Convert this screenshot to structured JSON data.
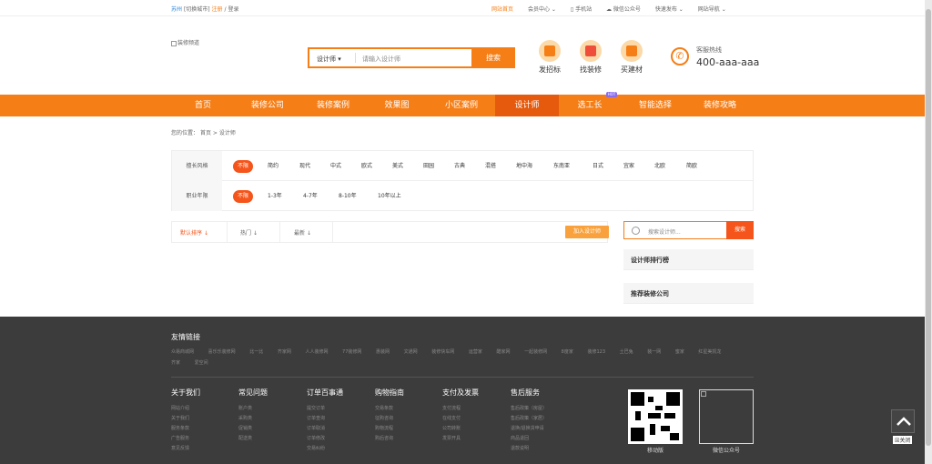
{
  "topbar": {
    "city": "苏州",
    "switch_city": "[切换城市]",
    "register": "注册",
    "slash": "/",
    "login": "登录",
    "site_home": "网站首页",
    "member_center": "会员中心",
    "mobile": "手机站",
    "wechat": "微信公众号",
    "quick_publish": "快速发布",
    "site_nav": "网站导航"
  },
  "header": {
    "logo_alt": "装修频道",
    "search_select": "设计师",
    "search_placeholder": "请输入设计师",
    "search_button": "搜索",
    "quick_links": [
      "发招标",
      "找装修",
      "买建材"
    ],
    "hotline_label": "客服热线",
    "hotline_number": "400-aaa-aaa"
  },
  "nav": {
    "items": [
      "首页",
      "装修公司",
      "装修案例",
      "效果图",
      "小区案例",
      "设计师",
      "选工长",
      "智能选择",
      "装修攻略"
    ],
    "active": "设计师",
    "hot_badge": "HOT"
  },
  "breadcrumb": {
    "prefix": "您的位置：",
    "home": "首页",
    "sep": ">",
    "current": "设计师"
  },
  "filters": {
    "style_label": "擅长风格",
    "styles": [
      "不限",
      "简约",
      "现代",
      "中式",
      "欧式",
      "美式",
      "田园",
      "古典",
      "混搭",
      "地中海",
      "东南亚",
      "日式",
      "宜家",
      "北欧",
      "简欧"
    ],
    "years_label": "职业年限",
    "years": [
      "不限",
      "1-3年",
      "4-7年",
      "8-10年",
      "10年以上"
    ]
  },
  "sort": {
    "default": "默认排序",
    "hot": "热门",
    "new": "最新",
    "arrow": "↓",
    "join_button": "加入设计师"
  },
  "sidebar": {
    "search_placeholder": "搜索设计师...",
    "search_button": "搜索",
    "rank_title": "设计师排行榜",
    "recommend_title": "推荐装修公司"
  },
  "footer": {
    "friend_links_title": "友情链接",
    "friend_links": [
      "众易商城网",
      "喜乐乐装修网",
      "比一比",
      "齐家网",
      "人人装修网",
      "77装修网",
      "惠装网",
      "文通网",
      "装修快车网",
      "运营家",
      "酷家网",
      "一起装修网",
      "8度家",
      "装修123",
      "土巴兔",
      "装一网",
      "蜜家",
      "红星美凯龙",
      "齐家",
      "爱空间"
    ],
    "columns": [
      {
        "title": "关于我们",
        "links": [
          "网站介绍",
          "关于我们",
          "服务条款",
          "广告服务",
          "意见反馈"
        ]
      },
      {
        "title": "常见问题",
        "links": [
          "账户类",
          "采购类",
          "促销类",
          "配送类"
        ]
      },
      {
        "title": "订单百事通",
        "links": [
          "提交订单",
          "订单查询",
          "订单取消",
          "订单修改",
          "交易纠纷"
        ]
      },
      {
        "title": "购物指南",
        "links": [
          "交易条款",
          "征购咨询",
          "购物流程",
          "购后咨询"
        ]
      },
      {
        "title": "支付及发票",
        "links": [
          "支付流程",
          "在线支付",
          "公司转账",
          "发票开具"
        ]
      },
      {
        "title": "售后服务",
        "links": [
          "售后政策（房屋）",
          "售后政策（家居）",
          "退换/退换货申请",
          "商品退回",
          "退款说明"
        ]
      }
    ],
    "qr_mobile_label": "移动版",
    "qr_wechat_label": "微信公众号",
    "close_label": "关闭",
    "close_icon_text": "☒"
  }
}
